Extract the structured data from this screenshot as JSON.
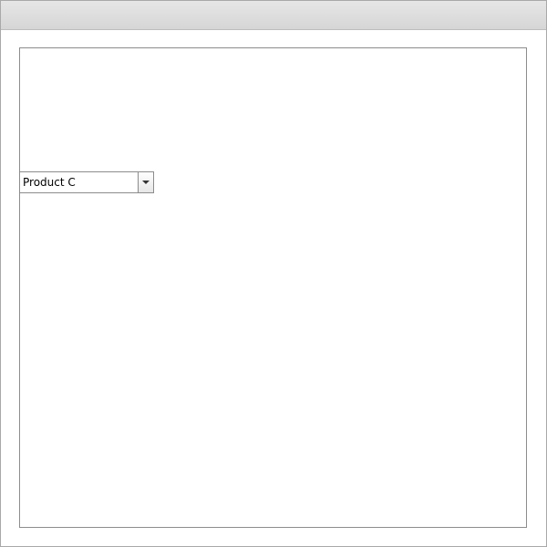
{
  "window": {
    "title": ""
  },
  "dropdown": {
    "selected_value": "Product C",
    "icon": "chevron-down-icon"
  }
}
